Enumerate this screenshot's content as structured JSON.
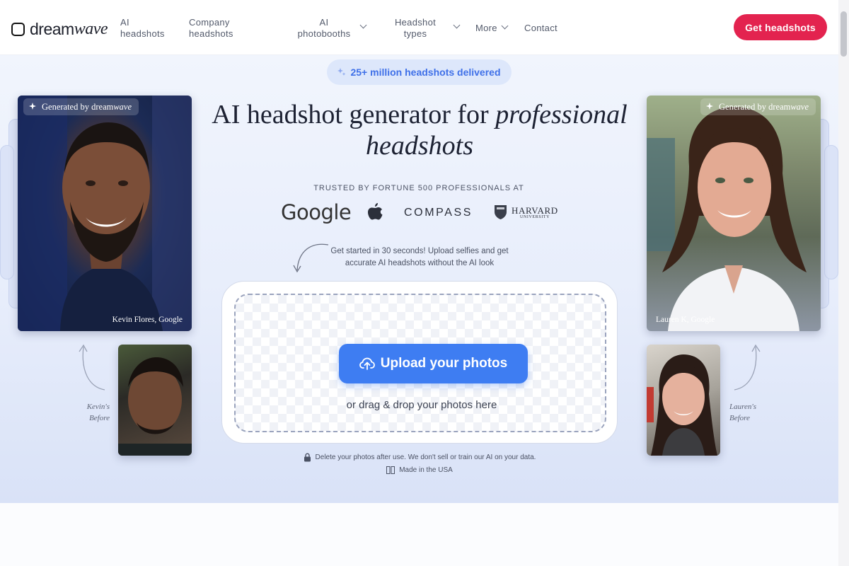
{
  "nav": {
    "logo_prefix": "dream",
    "logo_suffix": "wave",
    "links": [
      {
        "line1": "AI",
        "line2": "headshots"
      },
      {
        "line1": "Company",
        "line2": "headshots"
      },
      {
        "line1": "AI",
        "line2": "photobooths"
      },
      {
        "line1": "Headshot",
        "line2": "types"
      },
      {
        "line1": "More",
        "line2": ""
      },
      {
        "line1": "Contact",
        "line2": ""
      }
    ],
    "cta_label": "Get headshots"
  },
  "hero": {
    "badge": "25+ million headshots delivered",
    "headline_plain": "AI headshot generator for",
    "headline_italic_1": "professional",
    "headline_italic_2": "headshots",
    "trusted": "TRUSTED BY FORTUNE 500 PROFESSIONALS AT",
    "brands": [
      "Google",
      "COMPASS",
      "HARVARD",
      "UNIVERSITY"
    ],
    "note": "Get started in 30 seconds! Upload selfies and get accurate AI headshots without the AI look",
    "upload_label": "Upload your photos",
    "drag_text": "or drag & drop your photos here",
    "privacy": "Delete your photos after use. We don't sell or train our AI on your data.",
    "made_in": "Made in the USA"
  },
  "photos": {
    "generated_prefix": "Generated by dream",
    "generated_suffix": "wave",
    "left_caption": "Kevin Flores, Google",
    "right_caption": "Lauren K, Google",
    "left_before_1": "Kevin's",
    "left_before_2": "Before",
    "right_before_1": "Lauren's",
    "right_before_2": "Before"
  },
  "colors": {
    "accent": "#e3234f",
    "primary": "#3e7df2",
    "badge_text": "#3f70e8"
  }
}
